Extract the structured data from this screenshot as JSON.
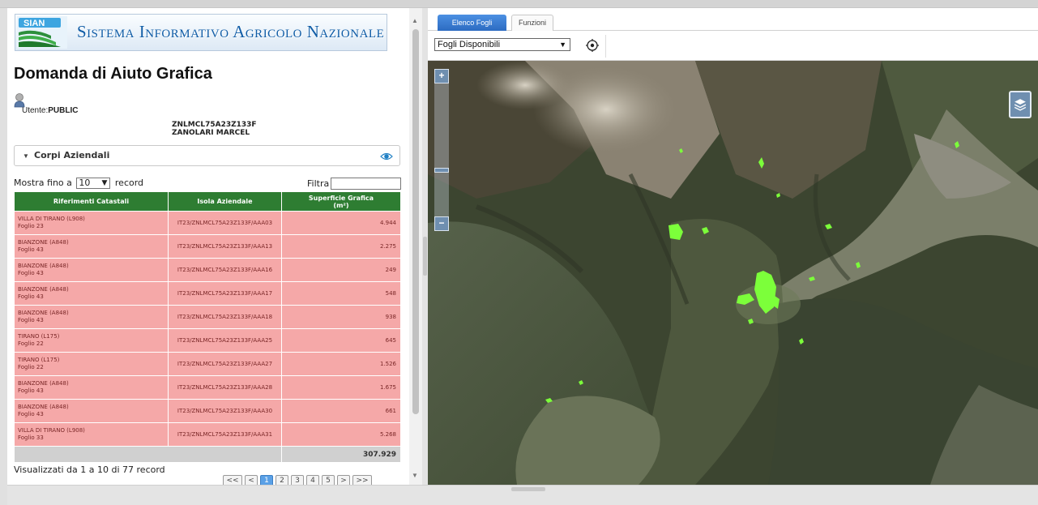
{
  "header": {
    "logo_text": "SIAN",
    "system_title": "Sistema Informativo Agricolo Nazionale"
  },
  "page": {
    "title": "Domanda di Aiuto Grafica"
  },
  "user": {
    "label": "Utente:",
    "name": "PUBLIC"
  },
  "farmer": {
    "code": "ZNLMCL75A23Z133F",
    "name": "ZANOLARI MARCEL"
  },
  "section": {
    "title": "Corpi Aziendali",
    "icon": "eye-icon"
  },
  "table_controls": {
    "show_prefix": "Mostra fino a",
    "show_value": "10",
    "show_suffix": "record",
    "filter_label": "Filtra",
    "filter_value": ""
  },
  "table": {
    "columns": [
      "Riferimenti Catastali",
      "Isola Aziendale",
      "Superficie Grafica",
      "(m²)"
    ],
    "rows": [
      {
        "ref": "VILLA DI TIRANO (L908)",
        "sheet": "Foglio 23",
        "isola": "IT23/ZNLMCL75A23Z133F/AAA03",
        "sup": "4.944"
      },
      {
        "ref": "BIANZONE (A848)",
        "sheet": "Foglio 43",
        "isola": "IT23/ZNLMCL75A23Z133F/AAA13",
        "sup": "2.275"
      },
      {
        "ref": "BIANZONE (A848)",
        "sheet": "Foglio 43",
        "isola": "IT23/ZNLMCL75A23Z133F/AAA16",
        "sup": "249"
      },
      {
        "ref": "BIANZONE (A848)",
        "sheet": "Foglio 43",
        "isola": "IT23/ZNLMCL75A23Z133F/AAA17",
        "sup": "548"
      },
      {
        "ref": "BIANZONE (A848)",
        "sheet": "Foglio 43",
        "isola": "IT23/ZNLMCL75A23Z133F/AAA18",
        "sup": "938"
      },
      {
        "ref": "TIRANO (L175)",
        "sheet": "Foglio 22",
        "isola": "IT23/ZNLMCL75A23Z133F/AAA25",
        "sup": "645"
      },
      {
        "ref": "TIRANO (L175)",
        "sheet": "Foglio 22",
        "isola": "IT23/ZNLMCL75A23Z133F/AAA27",
        "sup": "1.526"
      },
      {
        "ref": "BIANZONE (A848)",
        "sheet": "Foglio 43",
        "isola": "IT23/ZNLMCL75A23Z133F/AAA28",
        "sup": "1.675"
      },
      {
        "ref": "BIANZONE (A848)",
        "sheet": "Foglio 43",
        "isola": "IT23/ZNLMCL75A23Z133F/AAA30",
        "sup": "661"
      },
      {
        "ref": "VILLA DI TIRANO (L908)",
        "sheet": "Foglio 33",
        "isola": "IT23/ZNLMCL75A23Z133F/AAA31",
        "sup": "5.268"
      }
    ],
    "total": "307.929"
  },
  "footer": {
    "status": "Visualizzati da 1 a 10 di 77 record"
  },
  "pagination": {
    "first": "<<",
    "prev": "<",
    "pages": [
      "1",
      "2",
      "3",
      "4",
      "5"
    ],
    "active": "1",
    "next": ">",
    "last": ">>"
  },
  "right_tabs": {
    "elenco": "Elenco Fogli",
    "funzioni": "Funzioni"
  },
  "map_toolbar": {
    "select_value": "Fogli Disponibili",
    "locate_icon": "crosshair-icon"
  },
  "map_controls": {
    "zoom_in": "+",
    "zoom_out": "−",
    "layers_icon": "layers-icon"
  },
  "colors": {
    "table_header": "#2e7d32",
    "row_bg": "#f5a8a8",
    "tab_active": "#2c6bc1",
    "sian_title": "#0f5ca6"
  }
}
